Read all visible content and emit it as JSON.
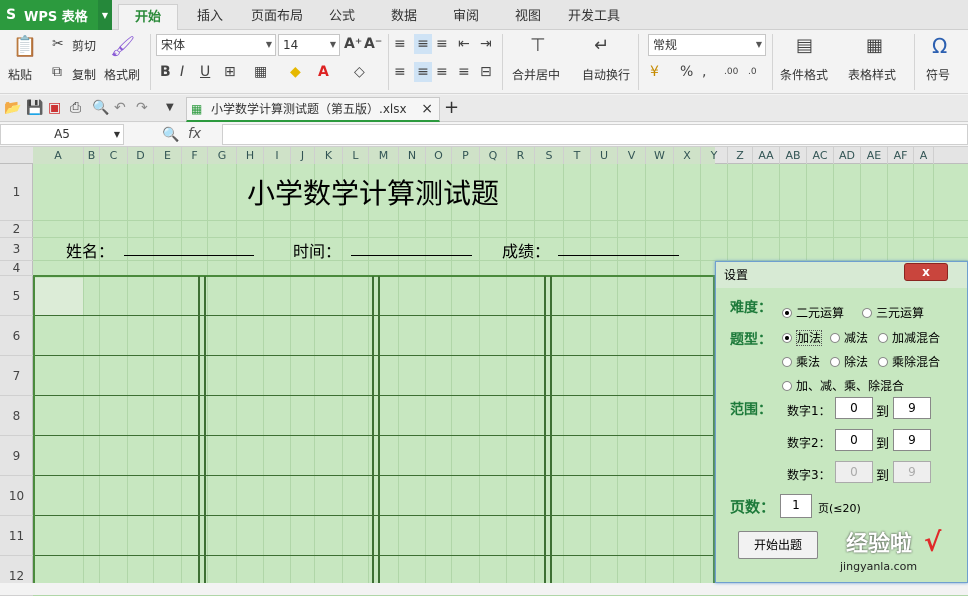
{
  "app": {
    "brand": "WPS 表格",
    "logo": "S"
  },
  "tabs": [
    "开始",
    "插入",
    "页面布局",
    "公式",
    "数据",
    "审阅",
    "视图",
    "开发工具"
  ],
  "ribbon": {
    "paste": "粘贴",
    "cut": "剪切",
    "copy": "复制",
    "format_painter": "格式刷",
    "font": "宋体",
    "size": "14",
    "merge_center": "合并居中",
    "wrap": "自动换行",
    "number_format": "常规",
    "cond_format": "条件格式",
    "table_style": "表格样式",
    "symbol": "符号"
  },
  "doc": {
    "tab_title": "小学数学计算测试题（第五版）.xlsx",
    "close": "×",
    "add": "+"
  },
  "formula": {
    "cell_ref": "A5",
    "fx": "fx"
  },
  "columns": [
    "A",
    "B",
    "C",
    "D",
    "E",
    "F",
    "G",
    "H",
    "I",
    "J",
    "K",
    "L",
    "M",
    "N",
    "O",
    "P",
    "Q",
    "R",
    "S",
    "T",
    "U",
    "V",
    "W",
    "X",
    "Y",
    "Z",
    "AA",
    "AB",
    "AC",
    "AD",
    "AE",
    "AF",
    "A"
  ],
  "rows": [
    "1",
    "2",
    "3",
    "4",
    "5",
    "6",
    "7",
    "8",
    "9",
    "10",
    "11",
    "12"
  ],
  "sheet": {
    "title": "小学数学计算测试题",
    "name_label": "姓名：",
    "time_label": "时间：",
    "score_label": "成绩："
  },
  "dialog": {
    "title": "设置",
    "close": "x",
    "difficulty_label": "难度：",
    "diff_options": [
      "二元运算",
      "三元运算"
    ],
    "type_label": "题型：",
    "type_options": [
      "加法",
      "减法",
      "加减混合",
      "乘法",
      "除法",
      "乘除混合",
      "加、减、乘、除混合"
    ],
    "range_label": "范围：",
    "num1_label": "数字1：",
    "num1_from": "0",
    "num1_to": "9",
    "num2_label": "数字2：",
    "num2_from": "0",
    "num2_to": "9",
    "num3_label": "数字3：",
    "num3_from": "0",
    "num3_to": "9",
    "to": "到",
    "pages_label": "页数：",
    "pages_value": "1",
    "pages_hint": "页(≤20)",
    "start_button": "开始出题"
  },
  "watermark": {
    "text": "经验啦",
    "url": "jingyanla.com",
    "check": "√"
  },
  "colors": {
    "brand": "#2c9a3e",
    "sheet_bg": "#c7e7c0",
    "accent_text": "#1d7a3a"
  }
}
